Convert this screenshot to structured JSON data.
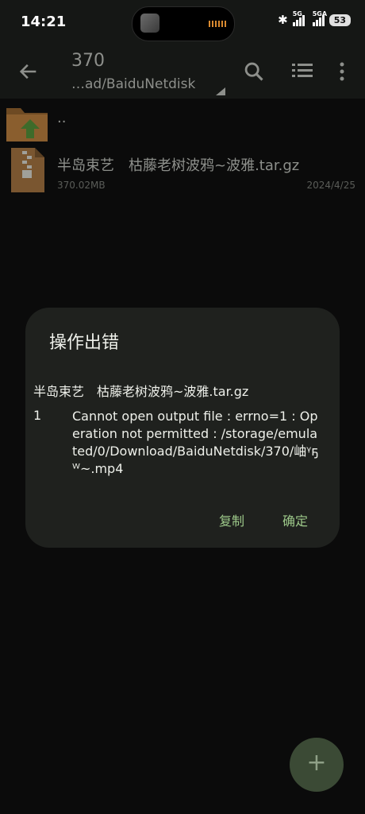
{
  "status_bar": {
    "time": "14:21",
    "network1": "5G",
    "network2": "5GA",
    "battery": "53"
  },
  "app_bar": {
    "title": "370",
    "path": "…ad/BaiduNetdisk"
  },
  "files": [
    {
      "name": "..",
      "icon": "parent-folder-icon"
    },
    {
      "name": "半岛束艺　枯藤老树波鸦~波雅.tar.gz",
      "size": "370.02MB",
      "date": "2024/4/25",
      "icon": "archive-file-icon"
    }
  ],
  "dialog": {
    "title": "操作出错",
    "file": "半岛束艺　枯藤老树波鸦~波雅.tar.gz",
    "error_index": "1",
    "message": "Cannot open output file : errno=1 : Operation not permitted : /storage/emulated/0/Download/BaiduNetdisk/370/岫ᵞҕ  ᵂ~.mp4",
    "copy_label": "复制",
    "ok_label": "确定"
  },
  "fab": {
    "label": "+"
  },
  "colors": {
    "accent": "#9cc889",
    "dialog_bg": "#1f211e",
    "background": "#0b0b0b"
  }
}
